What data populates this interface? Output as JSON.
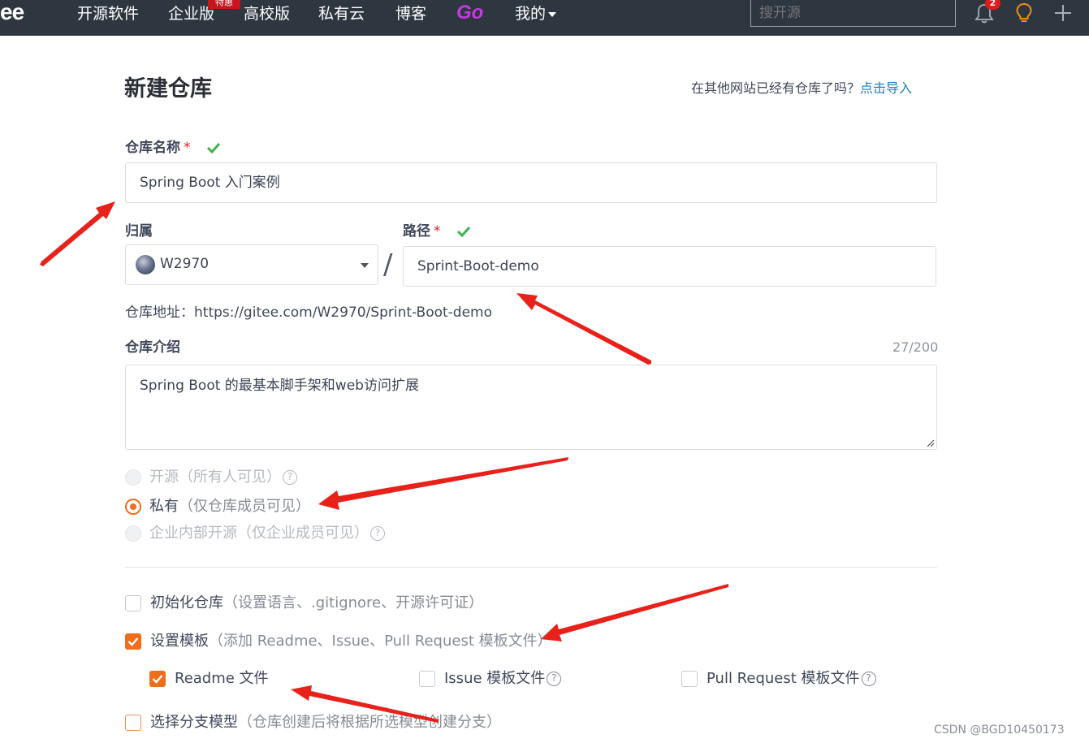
{
  "nav": {
    "logo": "ee",
    "items": [
      "开源软件",
      "企业版",
      "高校版",
      "私有云",
      "博客"
    ],
    "promo_badge": "特惠",
    "go": "Go",
    "mine": "我的",
    "search_placeholder": "搜开源",
    "notification_count": "2"
  },
  "page": {
    "title": "新建仓库",
    "import_hint": "在其他网站已经有仓库了吗？",
    "import_link": "点击导入"
  },
  "form": {
    "repo_name_label": "仓库名称",
    "required_mark": "*",
    "repo_name_value": "Spring Boot 入门案例",
    "owner_label": "归属",
    "owner_value": "W2970",
    "separator": "/",
    "path_label": "路径",
    "path_value": "Sprint-Boot-demo",
    "address": "仓库地址：https://gitee.com/W2970/Sprint-Boot-demo",
    "intro_label": "仓库介绍",
    "intro_counter": "27/200",
    "intro_value": "Spring Boot 的最基本脚手架和web访问扩展"
  },
  "visibility": {
    "options": [
      {
        "label": "开源",
        "note": "（所有人可见）",
        "help": "?",
        "state": "disabled"
      },
      {
        "label": "私有",
        "note": "（仅仓库成员可见）",
        "help": "",
        "state": "selected"
      },
      {
        "label": "企业内部开源",
        "note": "（仅企业成员可见）",
        "help": "?",
        "state": "disabled"
      }
    ]
  },
  "options": {
    "init_repo": {
      "label": "初始化仓库",
      "note": "（设置语言、.gitignore、开源许可证）",
      "checked": false
    },
    "template": {
      "label": "设置模板",
      "note": "（添加 Readme、Issue、Pull Request 模板文件）",
      "checked": true
    },
    "readme": {
      "label": "Readme 文件",
      "checked": true
    },
    "issue": {
      "label": "Issue 模板文件",
      "help": "?",
      "checked": false
    },
    "pr": {
      "label": "Pull Request 模板文件",
      "help": "?",
      "checked": false
    },
    "branch_model": {
      "label": "选择分支模型",
      "note": "（仓库创建后将根据所选模型创建分支）",
      "checked": false
    }
  },
  "watermark": "CSDN @BGD10450173",
  "colors": {
    "nav_bg": "#2e3640",
    "accent": "#ee6e1b",
    "link": "#1f7cb8",
    "annotation_arrow": "#e8211b",
    "success_check": "#3cb44b"
  }
}
